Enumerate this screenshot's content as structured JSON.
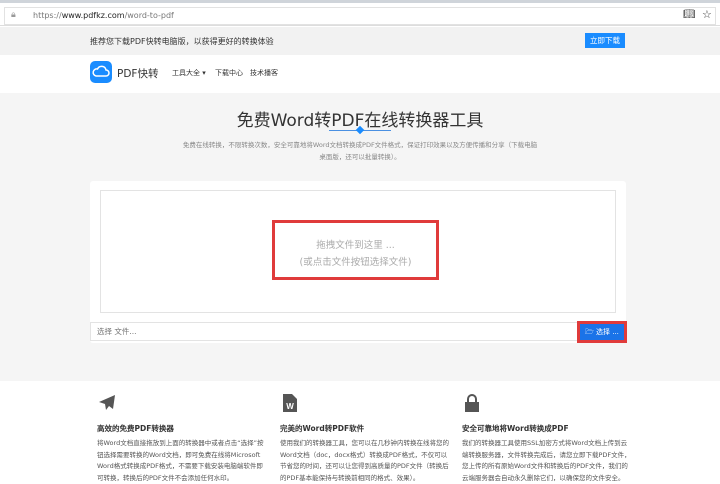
{
  "browser": {
    "url_prefix": "https://",
    "url_domain": "www.pdfkz.com",
    "url_path": "/word-to-pdf"
  },
  "banner": {
    "text": "推荐您下载PDF快转电脑版，以获得更好的转换体验",
    "button": "立即下载"
  },
  "nav": {
    "brand": "PDF快转",
    "items": [
      "工具大全 ▾",
      "下载中心",
      "技术播客"
    ]
  },
  "hero": {
    "title": "免费Word转PDF在线转换器工具",
    "description": "免费在线转换，不限转换次数，安全可靠地将Word文档转换成PDF文件格式，保证打印效果以及方便传播和分享（下载电脑桌面版，还可以批量转换）。"
  },
  "upload": {
    "drop_line1": "拖拽文件到这里 ...",
    "drop_line2": "(或点击文件按钮选择文件)",
    "input_placeholder": "选择 文件...",
    "choose_button": "选择 ..."
  },
  "features": [
    {
      "icon": "paper-plane-icon",
      "title": "高效的免费PDF转换器",
      "text": "将Word文档直接拖放到上面的转换器中或者点击“选择”按钮选择需要转换的Word文档，即可免费在线将Microsoft Word格式转换成PDF格式，不需要下载安装电脑端软件即可转换，转换后的PDF文件不会添加任何水印。"
    },
    {
      "icon": "word-file-icon",
      "title": "完美的Word转PDF软件",
      "text": "使用我们的转换器工具，您可以在几秒钟内转换在线将您的Word文档（doc，docx格式）转换成PDF格式，不仅可以节省您的时间，还可以让您得到高质量的PDF文件（转换后的PDF基本能保持与转换前相同的格式、效果）。"
    },
    {
      "icon": "lock-icon",
      "title": "安全可靠地将Word转换成PDF",
      "text": "我们的转换器工具使用SSL加密方式将Word文档上传到云端转换服务器，文件转换完成后，请您立即下载PDF文件，您上传的所有原始Word文件和转换后的PDF文件，我们的云端服务器会自动永久删除它们，以确保您的文件安全。"
    }
  ]
}
